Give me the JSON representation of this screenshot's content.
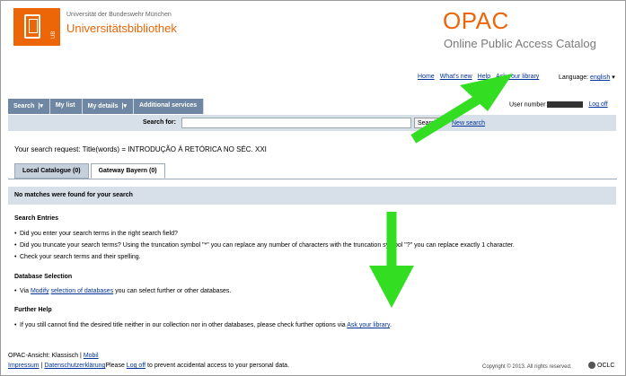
{
  "header": {
    "university": "Universität der Bundeswehr München",
    "library": "Universitätsbibliothek",
    "logo_badge": "UB",
    "opac_title": "OPAC",
    "opac_subtitle": "Online Public Access Catalog"
  },
  "toplinks": {
    "home": "Home",
    "whats_new": "What's new",
    "help": "Help",
    "ask_library": "Ask your library",
    "language_label": "Language:",
    "language_value": "english"
  },
  "nav": {
    "search": "Search",
    "my_list": "My list",
    "my_details": "My details",
    "additional": "Additional services",
    "user_number_label": "User number",
    "logoff": "Log off"
  },
  "search": {
    "label": "Search for:",
    "value": "",
    "button": "Search",
    "new_search": "New search"
  },
  "request": {
    "label": "Your search request:",
    "value": "Title(words) = INTRODUÇÃO Á RETÓRICA NO SÉC. XXI"
  },
  "tabs": [
    {
      "label": "Local Catalogue (0)"
    },
    {
      "label": "Gateway Bayern (0)"
    }
  ],
  "results": {
    "no_match": "No matches were found for your search",
    "entries_title": "Search Entries",
    "entries": [
      "Did you enter your search terms in the right search field?",
      "Did you truncate your search terms? Using the truncation symbol \"*\" you can replace any number of characters with the truncation symbol \"?\" you can replace exactly 1 character.",
      "Check your search terms and their spelling."
    ],
    "db_title": "Database Selection",
    "db_pre": "Via",
    "db_link1": "Modify",
    "db_link2": "selection of databases",
    "db_post": "you can select further or other databases.",
    "help_title": "Further Help",
    "help_pre": "If you still cannot find the desired title neither in our collection nor in other databases, please check further options via",
    "help_link": "Ask your library",
    "help_post": "."
  },
  "footer": {
    "ansicht": "OPAC-Ansicht:",
    "klassisch": "Klassisch",
    "mobil": "Mobil",
    "impressum": "Impressum",
    "datenschutz": "Datenschutzerklärung",
    "please": "Please",
    "logoff": "Log off",
    "logoff_post": "to prevent accidental access to your personal data.",
    "copyright": "Copyright © 2013. All rights reserved.",
    "oclc": "OCLC"
  },
  "colors": {
    "brand_orange": "#ec6608",
    "nav_blue": "#6f87a3",
    "arrow_green": "#33dd22"
  }
}
